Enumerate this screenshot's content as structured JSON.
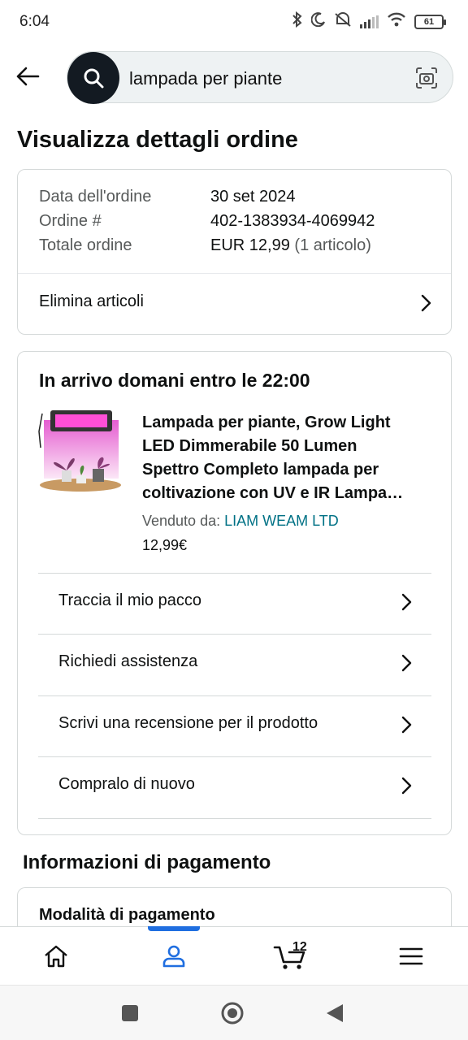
{
  "status_bar": {
    "time": "6:04",
    "battery": "61"
  },
  "search": {
    "query": "lampada per piante"
  },
  "page": {
    "title": "Visualizza dettagli ordine"
  },
  "order_summary": {
    "rows": [
      {
        "label": "Data dell'ordine",
        "value": "30 set 2024"
      },
      {
        "label": "Ordine #",
        "value": "402-1383934-4069942"
      },
      {
        "label": "Totale ordine",
        "value": "EUR 12,99",
        "extra": "(1 articolo)"
      }
    ],
    "remove_items": "Elimina articoli"
  },
  "delivery": {
    "heading": "In arrivo domani entro le 22:00",
    "product": {
      "title_lines": [
        "Lampada per piante, Grow Light",
        "LED Dimmerabile 50 Lumen",
        "Spettro Completo lampada per",
        "coltivazione con UV e IR Lampa…"
      ],
      "seller_prefix": "Venduto da:",
      "seller_name": "LIAM WEAM LTD",
      "price": "12,99€"
    },
    "actions": [
      "Traccia il mio pacco",
      "Richiedi assistenza",
      "Scrivi una recensione per il prodotto",
      "Compralo di nuovo"
    ]
  },
  "payment": {
    "section_title": "Informazioni di pagamento",
    "method_label": "Modalità di pagamento"
  },
  "bottom_nav": {
    "cart_count": "12",
    "items": [
      "home-icon",
      "account-icon",
      "cart-icon",
      "menu-icon"
    ],
    "active_color": "#1f6ee0"
  },
  "colors": {
    "link": "#007185",
    "search_circle": "#131a22"
  }
}
